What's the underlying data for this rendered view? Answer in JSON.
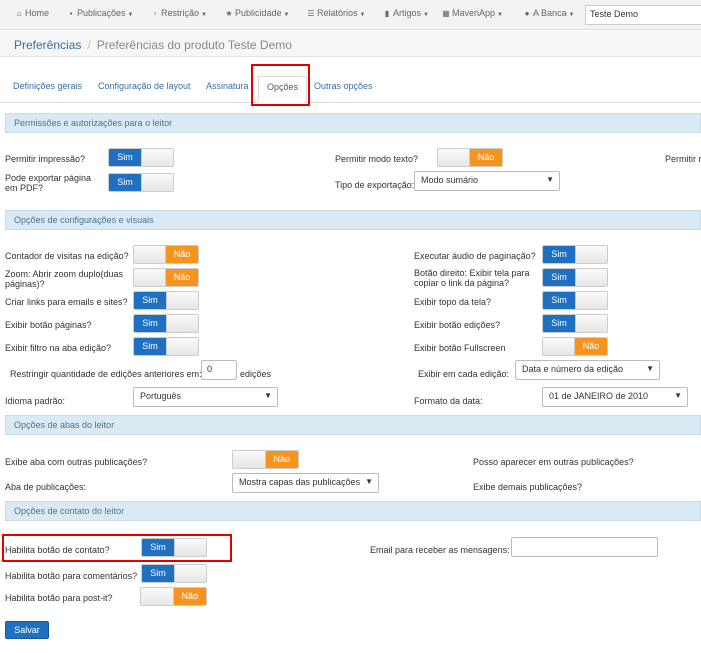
{
  "nav": {
    "items": [
      {
        "icon": "home-icon",
        "label": "Home",
        "caret": false
      },
      {
        "icon": "file-icon",
        "label": "Publicações",
        "caret": true
      },
      {
        "icon": "lock-icon",
        "label": "Restrição",
        "caret": true
      },
      {
        "icon": "star-icon",
        "label": "Publicidade",
        "caret": true
      },
      {
        "icon": "list-icon",
        "label": "Relatórios",
        "caret": true
      },
      {
        "icon": "bookmark-icon",
        "label": "Artigos",
        "caret": true
      },
      {
        "icon": "grid-icon",
        "label": "MavenApp",
        "caret": true
      },
      {
        "icon": "globe-icon",
        "label": "A Banca",
        "caret": true
      }
    ],
    "search_value": "Teste Demo"
  },
  "breadcrumb": {
    "root": "Preferências",
    "separator": "/",
    "current": "Preferências do produto Teste Demo"
  },
  "tabs": [
    "Definições gerais",
    "Configuração de layout",
    "Assinatura",
    "Opções",
    "Outras opções"
  ],
  "toggle_text": {
    "on": "Sim",
    "off": "Não"
  },
  "sections": {
    "perms": "Permissões e autorizações para o leitor",
    "visual": "Opções de configurações e visuais",
    "abas": "Opções de abas do leitor",
    "contato": "Opções de contato do leitor"
  },
  "perms": {
    "permitir_impressao": {
      "label": "Permitir impressão?",
      "value": "Sim"
    },
    "pode_exportar": {
      "label": "Pode exportar página em PDF?",
      "value": "Sim"
    },
    "permitir_texto": {
      "label": "Permitir modo texto?",
      "value": "Não"
    },
    "tipo_exportacao": {
      "label": "Tipo de exportação:",
      "value": "Modo sumário"
    },
    "cut_label": "Permitir r"
  },
  "visual": {
    "contador": {
      "label": "Contador de visitas na edição?",
      "value": "Não"
    },
    "zoom": {
      "label": "Zoom: Abrir zoom duplo(duas páginas)?",
      "value": "Não"
    },
    "links": {
      "label": "Criar links para emails e sites?",
      "value": "Sim"
    },
    "botao_paginas": {
      "label": "Exibir botão páginas?",
      "value": "Sim"
    },
    "filtro": {
      "label": "Exibir filtro na aba edição?",
      "value": "Sim"
    },
    "audio": {
      "label": "Executar áudio de paginação?",
      "value": "Sim"
    },
    "botao_direito": {
      "label": "Botão direito: Exibir tela para copiar o link da página?",
      "value": "Sim"
    },
    "topo": {
      "label": "Exibir topo da tela?",
      "value": "Sim"
    },
    "botao_edicoes": {
      "label": "Exibir botão edições?",
      "value": "Sim"
    },
    "fullscreen": {
      "label": "Exibir botão Fullscreen",
      "value": "Não"
    },
    "restringir": {
      "label": "Restringir quantidade de edições anteriores em:",
      "value": "0",
      "suffix": "edições"
    },
    "exibir_cada": {
      "label": "Exibir em cada edição:",
      "value": "Data e número da edição"
    },
    "idioma": {
      "label": "Idioma padrão:",
      "value": "Português"
    },
    "formato_data": {
      "label": "Formato da data:",
      "value": "01 de JANEIRO de 2010"
    }
  },
  "abas": {
    "outras_pub": {
      "label": "Exibe aba com outras publicações?",
      "value": "Não"
    },
    "aba_pub": {
      "label": "Aba de publicações:",
      "value": "Mostra capas das publicações"
    },
    "posso_aparecer": {
      "label": "Posso aparecer em outras publicações?"
    },
    "demais": {
      "label": "Exibe demais publicações?"
    }
  },
  "contato": {
    "habilita_contato": {
      "label": "Habilita botão de contato?",
      "value": "Sim"
    },
    "habilita_comentarios": {
      "label": "Habilita botão para comentários?",
      "value": "Sim"
    },
    "habilita_postit": {
      "label": "Habilita botão para post-it?",
      "value": "Não"
    },
    "email": {
      "label": "Email para receber as mensagens:",
      "value": ""
    }
  },
  "save_label": "Salvar",
  "colors": {
    "primary": "#1f70c1",
    "warning": "#f7941e",
    "section_bg": "#d9eaf4",
    "highlight": "#e00000"
  }
}
